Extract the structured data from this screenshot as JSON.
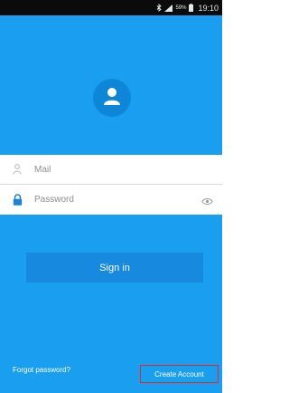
{
  "status_bar": {
    "time": "19:10",
    "battery_text": "59%",
    "icons": [
      "bluetooth-icon",
      "signal-icon",
      "battery-icon"
    ]
  },
  "avatar": {
    "icon": "user-icon"
  },
  "form": {
    "mail": {
      "placeholder": "Mail",
      "value": "",
      "icon": "person-icon"
    },
    "password": {
      "placeholder": "Password",
      "value": "",
      "icon": "lock-icon",
      "toggle_icon": "eye-icon"
    }
  },
  "sign_in_label": "Sign in",
  "footer": {
    "forgot_label": "Forgot password?",
    "create_label": "Create Account"
  },
  "colors": {
    "background": "#1a9ef0",
    "button": "#1789df",
    "accent_icon": "#1a84d6",
    "highlight_border": "#e02a2a"
  }
}
